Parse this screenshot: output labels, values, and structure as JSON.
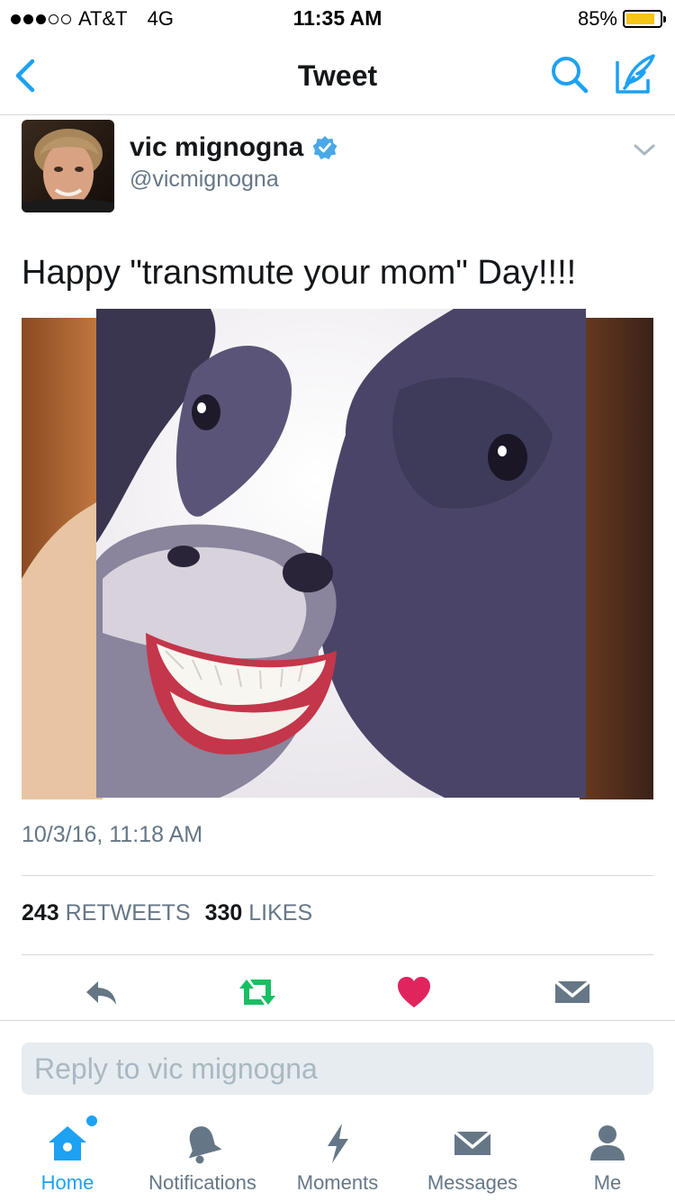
{
  "status_bar": {
    "carrier": "AT&T",
    "network": "4G",
    "time": "11:35 AM",
    "battery_percent": "85%",
    "battery_level": 0.85,
    "signal_bars_filled": 3,
    "signal_bars_total": 5
  },
  "nav": {
    "title": "Tweet",
    "icons": [
      "chevron-left-icon",
      "search-icon",
      "compose-icon"
    ]
  },
  "tweet": {
    "author_name": "vic mignogna",
    "author_handle": "@vicmignogna",
    "verified": true,
    "text": "Happy \"transmute your mom\" Day!!!!",
    "timestamp": "10/3/16, 11:18 AM",
    "retweets_count": "243",
    "retweets_label": "RETWEETS",
    "likes_count": "330",
    "likes_label": "LIKES",
    "liked": true
  },
  "reply": {
    "placeholder": "Reply to vic mignogna"
  },
  "tabs": [
    {
      "label": "Home",
      "icon": "home-icon",
      "active": true
    },
    {
      "label": "Notifications",
      "icon": "bell-icon",
      "active": false
    },
    {
      "label": "Moments",
      "icon": "lightning-icon",
      "active": false
    },
    {
      "label": "Messages",
      "icon": "envelope-icon",
      "active": false
    },
    {
      "label": "Me",
      "icon": "person-icon",
      "active": false
    }
  ],
  "colors": {
    "accent": "#1da1f2",
    "retweet": "#17bf63",
    "like": "#e0245e",
    "secondary_text": "#657786",
    "battery": "#f5c518"
  }
}
